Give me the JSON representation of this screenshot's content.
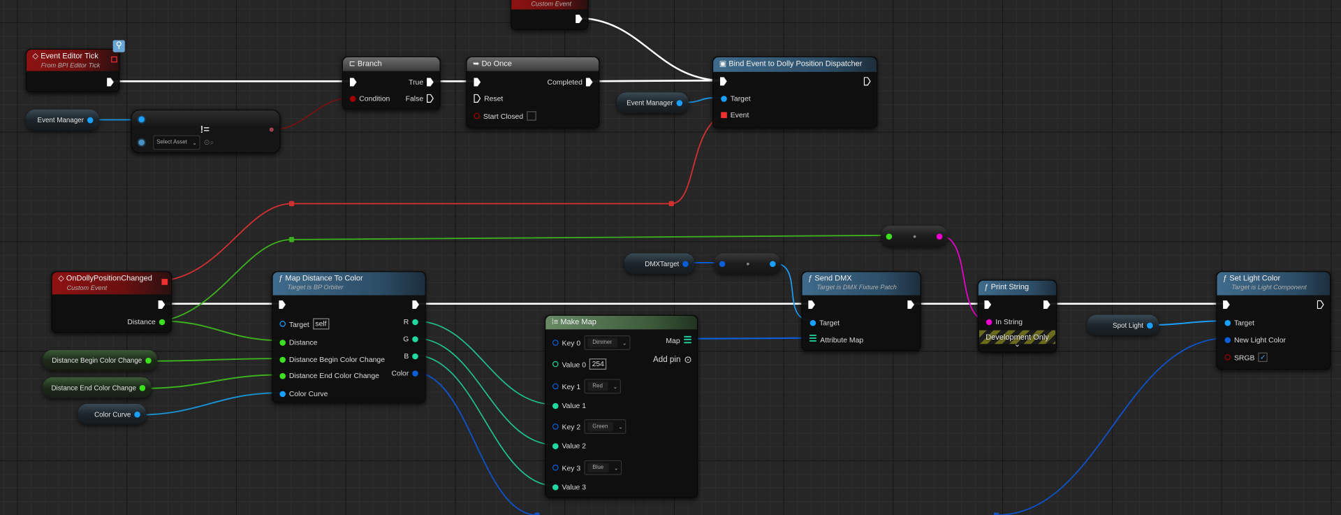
{
  "colors": {
    "exec": "#ffffff",
    "object": "#1aa0ff",
    "float": "#3ce01e",
    "struct": "#0a5fd8",
    "byte": "#20d8a0",
    "string": "#f000d0",
    "bool": "#8a0000",
    "delegate": "#f03030",
    "event_header": "#8e1212",
    "function_header": "#3f6b8c"
  },
  "nodes": {
    "custom_event_top": {
      "subtitle": "Custom Event"
    },
    "event_editor_tick": {
      "title": "Event Editor Tick",
      "subtitle": "From BPI Editor Tick"
    },
    "event_manager_var_left": {
      "label": "Event Manager"
    },
    "asset_node": {
      "select": "Select Asset"
    },
    "branch": {
      "title": "Branch",
      "true": "True",
      "false": "False",
      "condition": "Condition"
    },
    "do_once": {
      "title": "Do Once",
      "completed": "Completed",
      "reset": "Reset",
      "start_closed": "Start Closed"
    },
    "event_manager_var_right": {
      "label": "Event Manager"
    },
    "bind_event": {
      "title": "Bind Event to Dolly Position Dispatcher",
      "target": "Target",
      "event": "Event"
    },
    "on_dolly": {
      "title": "OnDollyPositionChanged",
      "subtitle": "Custom Event",
      "distance": "Distance"
    },
    "map_distance": {
      "title": "Map Distance To Color",
      "subtitle": "Target is BP Orbiter",
      "target": "Target",
      "target_value": "self",
      "distance": "Distance",
      "begin": "Distance Begin Color Change",
      "end": "Distance End Color Change",
      "curve": "Color Curve",
      "r": "R",
      "g": "G",
      "b": "B",
      "color": "Color"
    },
    "var_begin": {
      "label": "Distance Begin Color Change"
    },
    "var_end": {
      "label": "Distance End Color Change"
    },
    "var_curve": {
      "label": "Color Curve"
    },
    "make_map": {
      "title": "Make Map",
      "map": "Map",
      "add_pin": "Add pin",
      "rows": [
        {
          "label": "Key 0",
          "value": "Dimmer"
        },
        {
          "label": "Value 0",
          "value": "254"
        },
        {
          "label": "Key 1",
          "value": "Red"
        },
        {
          "label": "Value 1"
        },
        {
          "label": "Key 2",
          "value": "Green"
        },
        {
          "label": "Value 2"
        },
        {
          "label": "Key 3",
          "value": "Blue"
        },
        {
          "label": "Value 3"
        }
      ]
    },
    "dmx_target_var": {
      "label": "DMXTarget"
    },
    "send_dmx": {
      "title": "Send DMX",
      "subtitle": "Target is DMX Fixture Patch",
      "target": "Target",
      "attribute_map": "Attribute Map"
    },
    "print_string": {
      "title": "Print String",
      "in_string": "In String",
      "dev_only": "Development Only",
      "expand": "⌄"
    },
    "spot_light_var": {
      "label": "Spot Light"
    },
    "set_light_color": {
      "title": "Set Light Color",
      "subtitle": "Target is Light Component",
      "target": "Target",
      "new_color": "New Light Color",
      "srgb": "SRGB",
      "srgb_checked": true
    }
  }
}
